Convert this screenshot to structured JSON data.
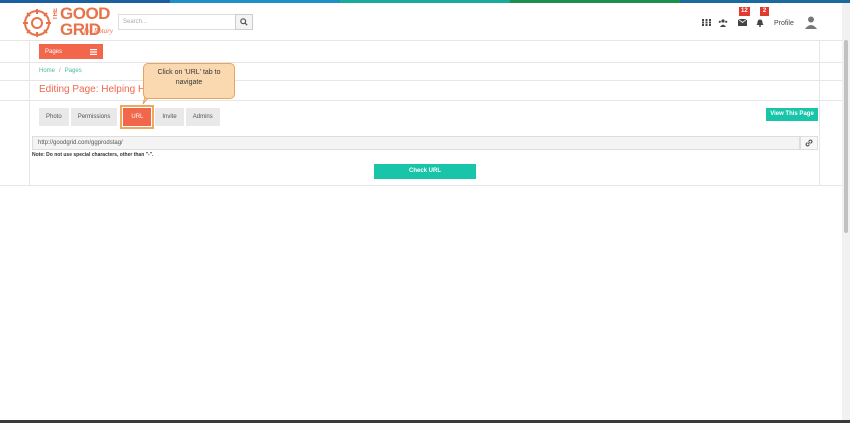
{
  "colors": {
    "strip": [
      "#1b5f9e",
      "#1f8fc7",
      "#1aa99a",
      "#1b8f4c",
      "#1a6aa0"
    ],
    "brand": "#f2674c",
    "accent": "#19c5a9"
  },
  "logo": {
    "the": "THE",
    "title_line1": "GOOD",
    "title_line2": "GRID",
    "sub": "for Rotary"
  },
  "search": {
    "placeholder": "Search..."
  },
  "header": {
    "icons": [
      "apps-grid-icon",
      "users-icon",
      "envelope-icon",
      "bell-icon"
    ],
    "messages_badge": "12",
    "notifications_badge": "2",
    "profile_label": "Profile"
  },
  "nav": {
    "pages_label": "Pages"
  },
  "breadcrumb": {
    "home": "Home",
    "current": "Pages"
  },
  "page": {
    "title": "Editing Page: Helping Han"
  },
  "tabs": [
    {
      "label": "Photo",
      "active": false
    },
    {
      "label": "Permissions",
      "active": false
    },
    {
      "label": "URL",
      "active": true
    },
    {
      "label": "Invite",
      "active": false
    },
    {
      "label": "Admins",
      "active": false
    }
  ],
  "view_button": "View This Page",
  "url": {
    "value": "http://goodgrid.com/ggprodstag/",
    "note": "Note: Do not use special characters, other than \"-\"."
  },
  "check_button": "Check URL",
  "tooltip": {
    "text": "Click on 'URL' tab to navigate"
  }
}
